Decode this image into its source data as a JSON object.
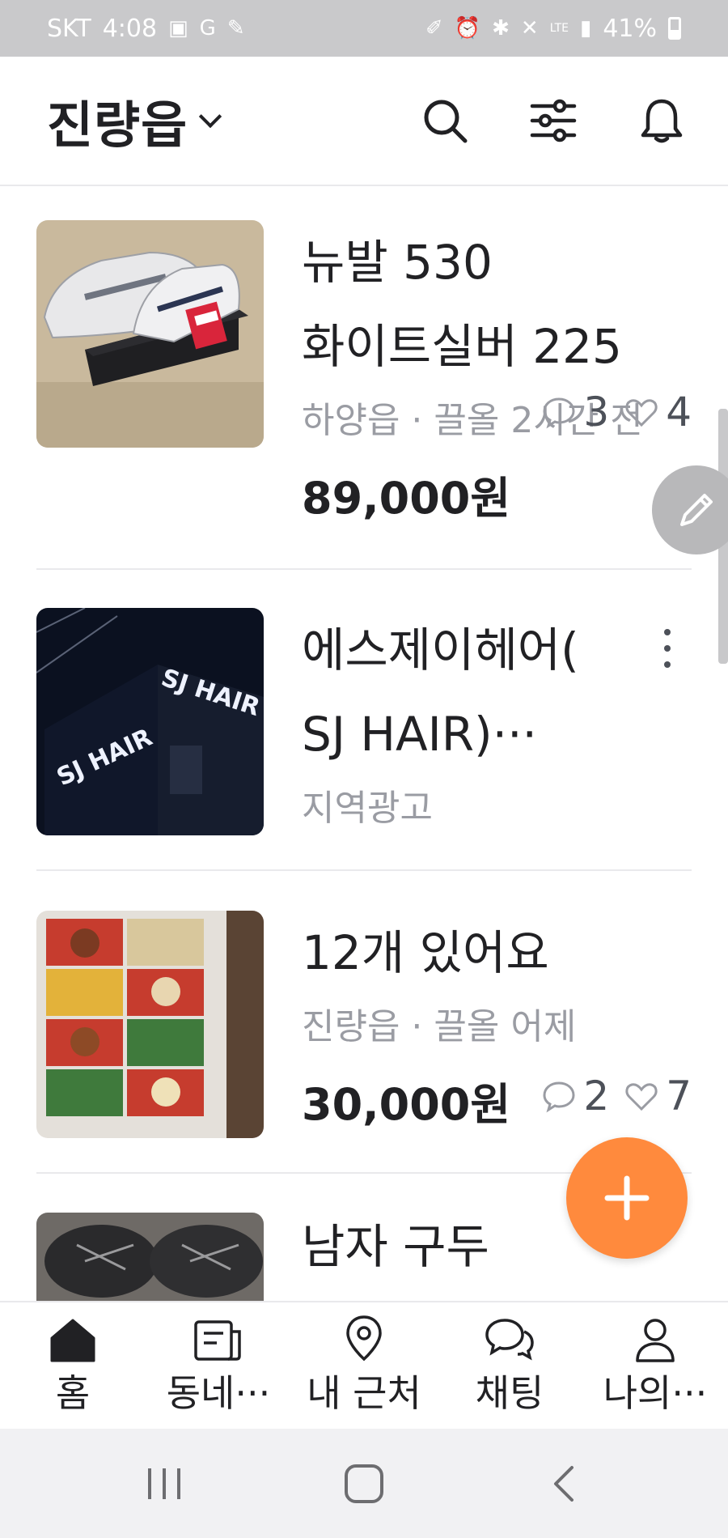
{
  "status_bar": {
    "carrier": "SKT",
    "time": "4:08",
    "network": "LTE",
    "battery": "41%",
    "battery_level": 0.41
  },
  "header": {
    "location": "진량읍"
  },
  "feed": {
    "items": [
      {
        "title_line1": "뉴발 530",
        "title_line2": "화이트실버 225",
        "meta": "하양읍 · 끌올 2시간 전",
        "price": "89,000원",
        "chats": "3",
        "likes": "4"
      },
      {
        "title_line1": "에스제이헤어(",
        "title_line2": "SJ HAIR)···",
        "meta": "지역광고",
        "image_sign_text": "SJ HAIR"
      },
      {
        "title_line1": "12개 있어요",
        "meta": "진량읍 · 끌올 어제",
        "price": "30,000원",
        "chats": "2",
        "likes": "7"
      },
      {
        "title_line1": "남자 구두"
      }
    ]
  },
  "bottom_nav": {
    "items": [
      {
        "label": "홈",
        "icon": "home-icon"
      },
      {
        "label": "동네···",
        "icon": "neighborhood-icon"
      },
      {
        "label": "내 근처",
        "icon": "location-pin-icon"
      },
      {
        "label": "채팅",
        "icon": "chat-icon"
      },
      {
        "label": "나의···",
        "icon": "person-icon"
      }
    ]
  },
  "colors": {
    "accent": "#ff8a3d",
    "text": "#212124",
    "subtext": "#9a9ca3"
  }
}
